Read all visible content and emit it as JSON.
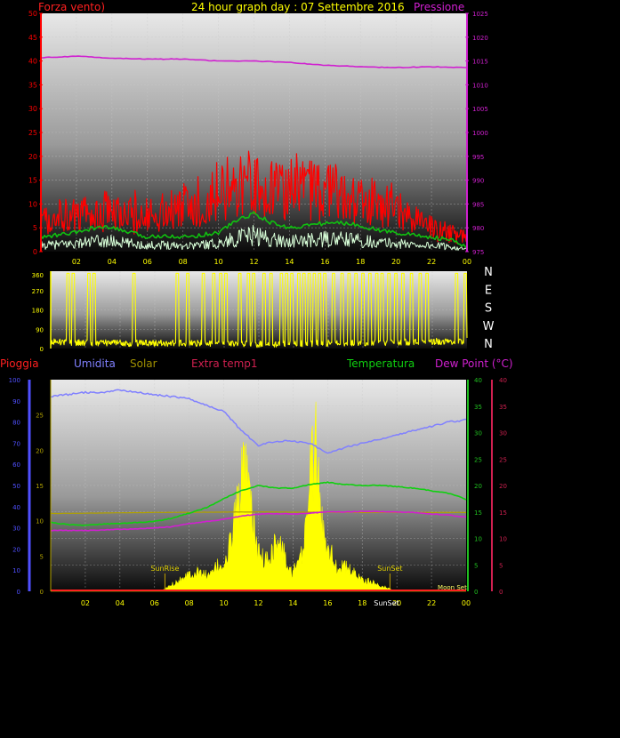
{
  "header": {
    "title": "24 hour graph day : 07 Settembre 2016",
    "wind_label": "Forza vento)",
    "pressure_label": "Pressione"
  },
  "colors": {
    "wind_gust": "#ff0000",
    "wind_avg": "#10c010",
    "wind_light": "#d8ffd8",
    "pressure": "#d020d0",
    "direction": "#ffff00",
    "humidity": "#8080ff",
    "solar": "#ffff00",
    "solar_axis": "#b0a000",
    "temperature": "#10d010",
    "dewpoint": "#d020d0",
    "rain": "#ff2020",
    "axis_left": "#5050ff",
    "axis_right_temp": "#20c020",
    "axis_right_dew": "#d02050",
    "x_ticks": "#ffff00"
  },
  "chart_data": [
    {
      "id": "wind",
      "type": "line",
      "x_ticks": [
        "02",
        "04",
        "06",
        "08",
        "10",
        "12",
        "14",
        "16",
        "18",
        "20",
        "22",
        "00"
      ],
      "y_left_label": "Forza vento)",
      "y_left_ticks": [
        "0",
        "5",
        "10",
        "15",
        "20",
        "25",
        "30",
        "35",
        "40",
        "45",
        "50"
      ],
      "y_left_lim": [
        0,
        50
      ],
      "y_right_label": "Pressione",
      "y_right_ticks": [
        "975",
        "980",
        "985",
        "990",
        "995",
        "1000",
        "1005",
        "1010",
        "1015",
        "1020",
        "1025"
      ],
      "y_right_lim": [
        975,
        1025
      ],
      "series": [
        {
          "key": "pressure",
          "x": [
            0,
            2,
            4,
            6,
            8,
            10,
            12,
            14,
            16,
            18,
            20,
            22,
            24
          ],
          "values": [
            1015.7,
            1016.0,
            1015.6,
            1015.4,
            1015.4,
            1015.0,
            1015.0,
            1014.7,
            1014.1,
            1013.8,
            1013.6,
            1013.8,
            1013.6
          ]
        },
        {
          "key": "gust",
          "x": [
            0,
            2,
            4,
            6,
            8,
            10,
            12,
            14,
            16,
            18,
            20,
            22,
            24
          ],
          "values": [
            8,
            9,
            10,
            10,
            11,
            15,
            17,
            16,
            17,
            13,
            11,
            6,
            3
          ]
        },
        {
          "key": "avg",
          "x": [
            0,
            1,
            2,
            3,
            4,
            5,
            6,
            7,
            8,
            9,
            10,
            11,
            12,
            13,
            14,
            15,
            16,
            17,
            18,
            19,
            20,
            21,
            22,
            23,
            24
          ],
          "values": [
            3.0,
            3.5,
            4.0,
            5.0,
            5.0,
            4.0,
            3.0,
            3.5,
            3.0,
            3.5,
            4.0,
            6.5,
            8.0,
            6.0,
            5.0,
            5.5,
            6.0,
            6.0,
            5.5,
            4.5,
            4.0,
            3.5,
            3.0,
            2.5,
            1.0
          ]
        }
      ]
    },
    {
      "id": "direction",
      "type": "line",
      "x_ticks": [],
      "y_left_ticks": [
        "0",
        "90",
        "180",
        "270",
        "360"
      ],
      "y_left_lim": [
        0,
        360
      ],
      "y_right_ticks": [
        "N",
        "W",
        "S",
        "E",
        "N"
      ],
      "series": [
        {
          "key": "direction",
          "x": [
            0,
            4,
            8,
            12,
            16,
            20,
            24
          ],
          "values": [
            30,
            25,
            25,
            20,
            25,
            30,
            35
          ]
        }
      ]
    },
    {
      "id": "climate",
      "type": "line",
      "x_ticks": [
        "02",
        "04",
        "06",
        "08",
        "10",
        "12",
        "14",
        "16",
        "18",
        "20",
        "22",
        "00"
      ],
      "legend": [
        "Pioggia",
        "Umidita",
        "Solar",
        "Extra temp1",
        "Temperatura",
        "Dew Point (°C)"
      ],
      "y_humidity_ticks": [
        "0",
        "10",
        "20",
        "30",
        "40",
        "50",
        "60",
        "70",
        "80",
        "90",
        "100"
      ],
      "y_humidity_lim": [
        0,
        100
      ],
      "y_rain_ticks": [
        "0",
        "5",
        "10",
        "15",
        "20",
        "25"
      ],
      "y_rain_lim": [
        0,
        30
      ],
      "y_temp_ticks": [
        "0",
        "5",
        "10",
        "15",
        "20",
        "25",
        "30",
        "35",
        "40"
      ],
      "y_temp_lim": [
        0,
        40
      ],
      "y_dew_ticks": [
        "0",
        "5",
        "10",
        "15",
        "20",
        "25",
        "30",
        "35",
        "40"
      ],
      "y_dew_lim": [
        0,
        40
      ],
      "annotations": [
        "SunRise",
        "SunSet",
        "SunSet",
        "Moon Set"
      ],
      "series": [
        {
          "key": "humidity",
          "x": [
            0,
            1,
            2,
            3,
            4,
            5,
            6,
            7,
            8,
            9,
            10,
            11,
            12,
            13,
            14,
            15,
            16,
            17,
            18,
            19,
            20,
            21,
            22,
            23,
            24
          ],
          "values": [
            92,
            93,
            94,
            94,
            95,
            94,
            93,
            92,
            91,
            88,
            85,
            76,
            69,
            71,
            71,
            70,
            65,
            68,
            70,
            72,
            74,
            76,
            78,
            80,
            81
          ]
        },
        {
          "key": "temperature",
          "x": [
            0,
            1,
            2,
            3,
            4,
            5,
            6,
            7,
            8,
            9,
            10,
            11,
            12,
            13,
            14,
            15,
            16,
            17,
            18,
            19,
            20,
            21,
            22,
            23,
            24
          ],
          "values": [
            13,
            12.6,
            12.5,
            12.7,
            12.8,
            13,
            13.2,
            13.8,
            14.8,
            15.8,
            17.5,
            19,
            20,
            19.5,
            19.5,
            20.2,
            20.6,
            20.2,
            20,
            20,
            19.8,
            19.5,
            19,
            18.5,
            17.4
          ]
        },
        {
          "key": "dewpoint",
          "x": [
            0,
            1,
            2,
            3,
            4,
            5,
            6,
            7,
            8,
            9,
            10,
            11,
            12,
            13,
            14,
            15,
            16,
            17,
            18,
            19,
            20,
            21,
            22,
            23,
            24
          ],
          "values": [
            11.5,
            11.5,
            11.5,
            11.6,
            11.7,
            11.8,
            12,
            12.2,
            12.8,
            13.2,
            13.6,
            14.2,
            14.6,
            14.7,
            14.6,
            14.8,
            15,
            15,
            15.1,
            15.1,
            15,
            14.9,
            14.6,
            14.4,
            14
          ]
        },
        {
          "key": "solar",
          "x": [
            0,
            6.4,
            7.5,
            8.0,
            8.7,
            9.2,
            9.6,
            10.2,
            10.6,
            11.2,
            11.6,
            12.0,
            12.5,
            13.0,
            13.4,
            13.8,
            14.3,
            14.6,
            15.0,
            15.3,
            15.6,
            16.0,
            16.5,
            17.0,
            17.5,
            18.0,
            18.5,
            19.0,
            19.5,
            20.0,
            24
          ],
          "values": [
            0,
            0,
            2,
            3,
            3,
            2.5,
            4,
            5,
            12,
            20,
            13,
            6,
            5,
            8,
            7,
            3,
            4,
            7,
            20,
            25,
            12,
            8,
            4,
            4,
            3,
            2,
            1.5,
            1,
            0.5,
            0,
            0
          ]
        },
        {
          "key": "solar_level",
          "x": [
            0,
            6,
            12,
            18,
            24
          ],
          "values": [
            14.7,
            14.9,
            15.0,
            14.9,
            14.9
          ]
        }
      ]
    }
  ]
}
